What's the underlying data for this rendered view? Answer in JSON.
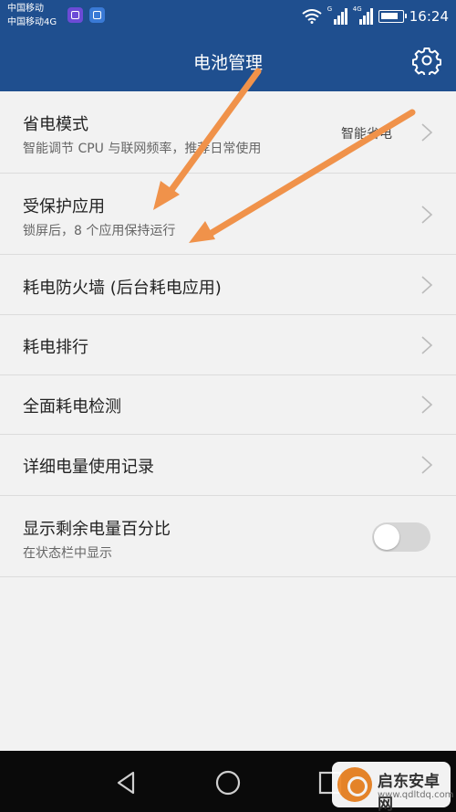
{
  "status_bar": {
    "carrier_1": "中国移动",
    "carrier_2": "中国移动4G",
    "signal_1_tag": "G",
    "signal_2_tag": "4G",
    "time": "16:24",
    "icons": [
      "app-notification-icon",
      "baidu-icon",
      "wifi-icon",
      "signal-icon",
      "signal-icon",
      "battery-icon"
    ]
  },
  "app_bar": {
    "title": "电池管理",
    "settings_icon": "gear-icon",
    "color": "#1f4f8f"
  },
  "list": {
    "items": [
      {
        "title": "省电模式",
        "subtitle": "智能调节 CPU 与联网频率，推荐日常使用",
        "value": "智能省电",
        "control": "chevron"
      },
      {
        "title": "受保护应用",
        "subtitle": "锁屏后，8 个应用保持运行",
        "control": "chevron"
      },
      {
        "title": "耗电防火墙 (后台耗电应用)",
        "control": "chevron"
      },
      {
        "title": "耗电排行",
        "control": "chevron"
      },
      {
        "title": "全面耗电检测",
        "control": "chevron"
      },
      {
        "title": "详细电量使用记录",
        "control": "chevron"
      },
      {
        "title": "显示剩余电量百分比",
        "subtitle": "在状态栏中显示",
        "control": "toggle",
        "toggle_on": false
      }
    ]
  },
  "annotation": {
    "arrow_color": "#f0924a"
  },
  "nav_bar": {
    "icons": [
      "back-icon",
      "home-icon",
      "recents-icon"
    ]
  },
  "watermark": {
    "name": "启东安卓网",
    "url": "www.qdltdq.com"
  }
}
